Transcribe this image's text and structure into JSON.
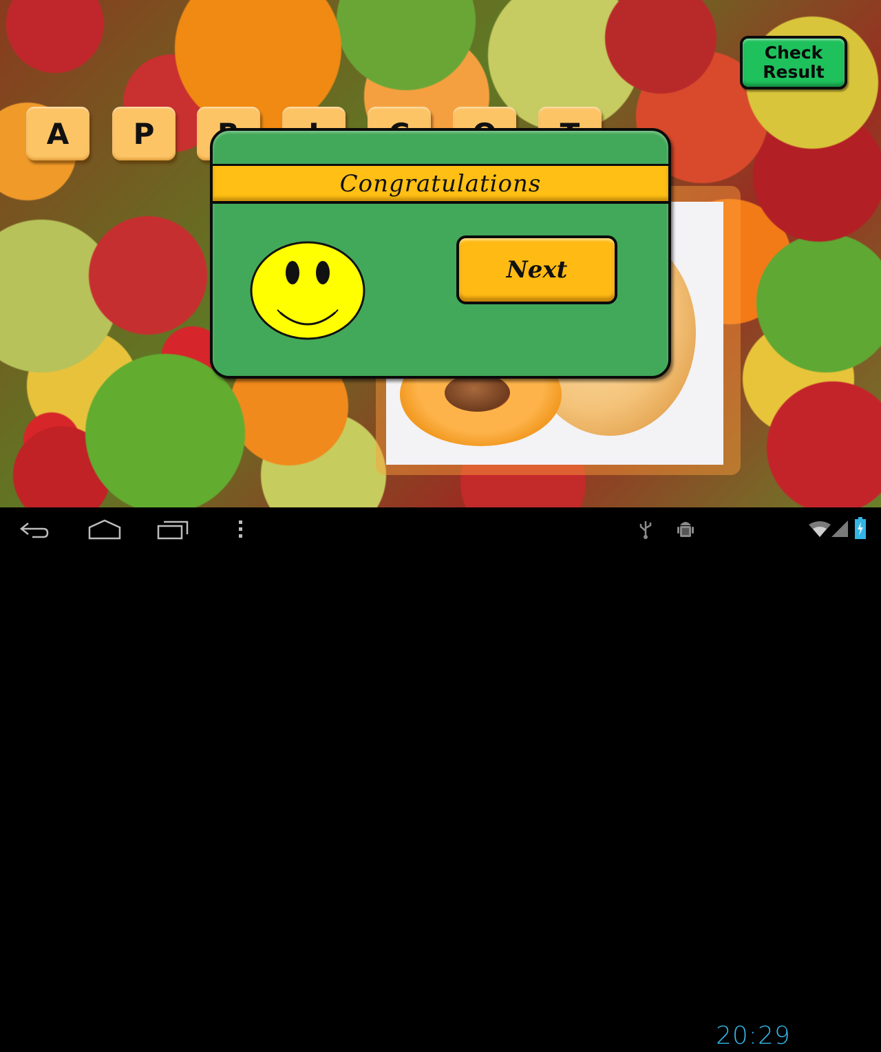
{
  "game": {
    "letter_tiles": [
      "A",
      "P",
      "R",
      "I",
      "C",
      "O",
      "T"
    ],
    "check_result_label": [
      "Check",
      "Result"
    ],
    "picture_subject": "apricot"
  },
  "dialog": {
    "title": "Congratulations",
    "icon": "smiley-face-icon",
    "next_label": "Next"
  },
  "system_bar": {
    "nav_icons": [
      "back-icon",
      "home-icon",
      "recent-apps-icon",
      "menu-overflow-icon"
    ],
    "status_icons": [
      "usb-icon",
      "android-debug-icon",
      "wifi-icon",
      "signal-icon",
      "battery-charging-icon"
    ],
    "time": "20:29",
    "accent_color": "#33b5e5"
  },
  "colors": {
    "dialog_green": "#42a95a",
    "header_yellow": "#ffbf14",
    "check_button_green": "#1fc15c",
    "tile_color": "#fdc466"
  }
}
